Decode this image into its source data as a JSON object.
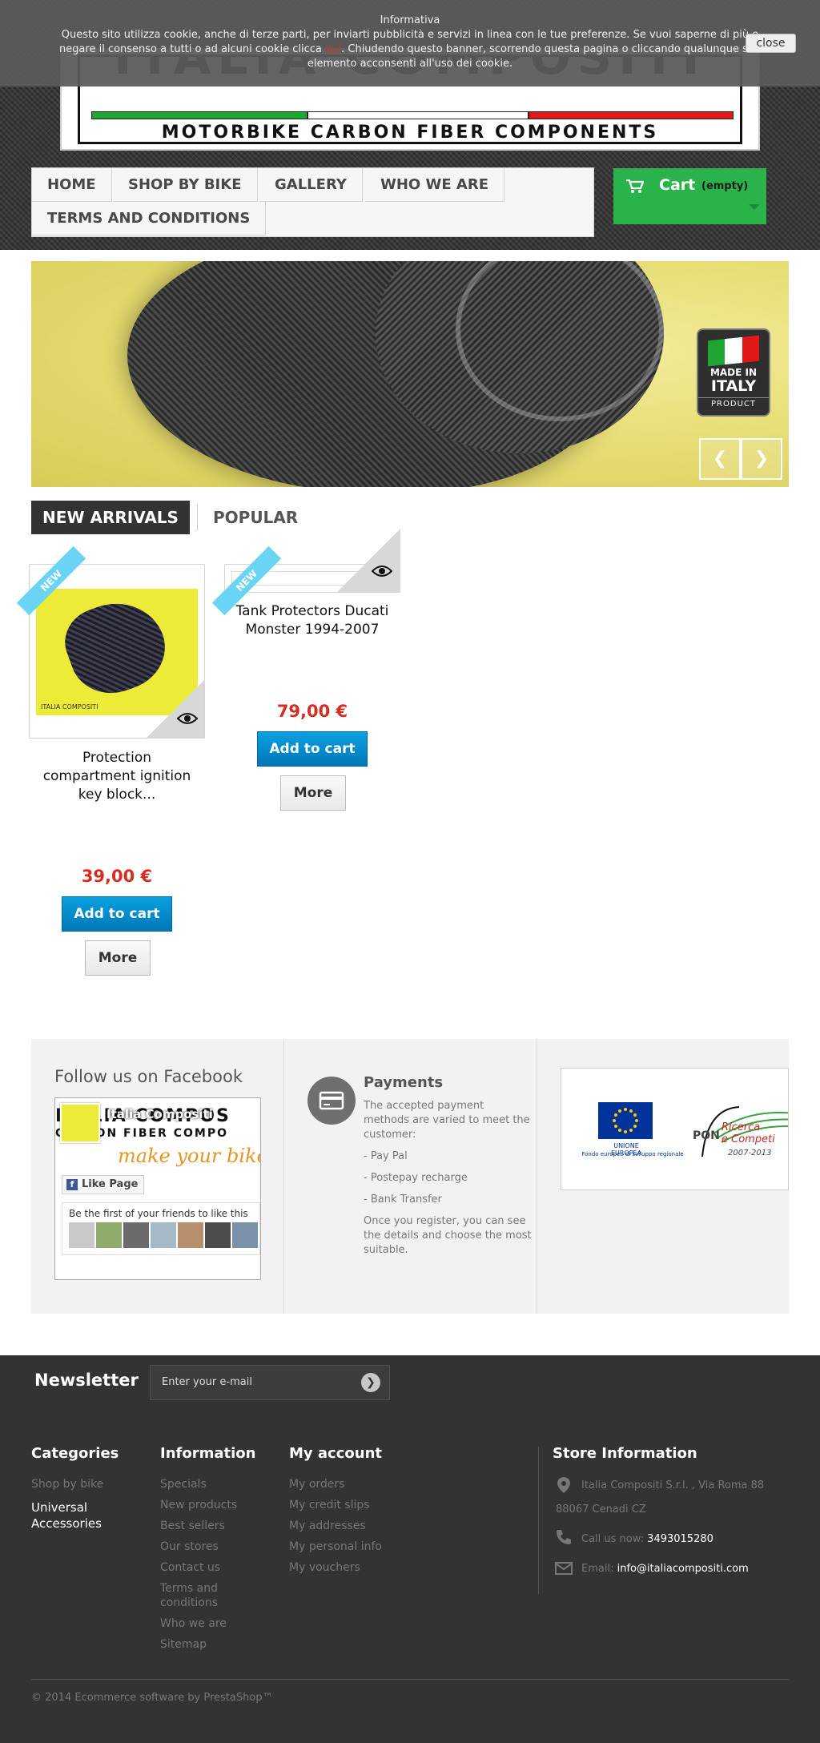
{
  "cookie": {
    "title": "Informativa",
    "text_before": "Questo sito utilizza cookie, anche di terze parti, per inviarti pubblicità e servizi in linea con le tue preferenze. Se vuoi saperne di più o negare il consenso a tutti o ad alcuni cookie clicca ",
    "link": "qui",
    "text_after": ". Chiudendo questo banner, scorrendo questa pagina o cliccando qualunque suo elemento acconsenti all'uso dei cookie.",
    "close": "close"
  },
  "logo": {
    "tagline": "MOTORBIKE CARBON FIBER COMPONENTS",
    "colors": {
      "green": "#1fa531",
      "white": "#ffffff",
      "red": "#e01818"
    }
  },
  "nav": {
    "items": [
      {
        "label": "HOME"
      },
      {
        "label": "SHOP BY BIKE"
      },
      {
        "label": "GALLERY"
      },
      {
        "label": "WHO WE ARE"
      },
      {
        "label": "TERMS AND CONDITIONS"
      }
    ]
  },
  "cart": {
    "label": "Cart",
    "status": "(empty)",
    "color": "#2ab34a"
  },
  "slider": {
    "badge": {
      "made": "MADE IN",
      "italy": "ITALY",
      "product": "PRODUCT"
    },
    "prev_icon": "chevron-left-icon",
    "next_icon": "chevron-right-icon"
  },
  "tabs": {
    "active": "NEW ARRIVALS",
    "inactive": "POPULAR"
  },
  "products": [
    {
      "name": "Protection compartment ignition key block...",
      "price": "39,00 €",
      "badge": "NEW",
      "brand": "ITALIA COMPOSITI",
      "add_to_cart": "Add to cart",
      "more": "More"
    },
    {
      "name": "Tank Protectors Ducati Monster 1994-2007",
      "price": "79,00 €",
      "badge": "NEW",
      "add_to_cart": "Add to cart",
      "more": "More"
    }
  ],
  "facebook": {
    "title": "Follow us on Facebook",
    "page_name": "Italia Compositi",
    "cover_text": "ITALIA COMPOS",
    "cover_sub": "CARBON FIBER COMPO",
    "cover_tag": "make your bike",
    "like": "Like Page",
    "friends": "Be the first of your friends to like this"
  },
  "payments": {
    "title": "Payments",
    "intro": "The accepted payment methods are varied to meet the customer:",
    "methods": [
      "- Pay Pal",
      "- Postepay recharge",
      "- Bank Transfer"
    ],
    "outro": "Once you register, you can see the details and choose the most suitable."
  },
  "funding": {
    "eu_label": "UNIONE EUROPEA",
    "eu_sub": "Fondo europeo di sviluppo regionale",
    "pon": "PON",
    "ricerca": "Ricerca",
    "competi": "e Competi",
    "years": "2007-2013"
  },
  "newsletter": {
    "title": "Newsletter",
    "placeholder": "Enter your e-mail"
  },
  "footer": {
    "categories": {
      "title": "Categories",
      "links": [
        "Shop by bike"
      ],
      "highlight": "Universal Accessories"
    },
    "information": {
      "title": "Information",
      "links": [
        "Specials",
        "New products",
        "Best sellers",
        "Our stores",
        "Contact us",
        "Terms and conditions",
        "Who we are",
        "Sitemap"
      ]
    },
    "account": {
      "title": "My account",
      "links": [
        "My orders",
        "My credit slips",
        "My addresses",
        "My personal info",
        "My vouchers"
      ]
    },
    "store": {
      "title": "Store Information",
      "address1": "Italia Compositi S.r.l. , Via Roma 88",
      "address2": "88067 Cenadi CZ",
      "call_label": "Call us now: ",
      "phone": "3493015280",
      "email_label": "Email: ",
      "email": "info@italiacompositi.com"
    },
    "copyright": "© 2014 Ecommerce software by PrestaShop™"
  }
}
